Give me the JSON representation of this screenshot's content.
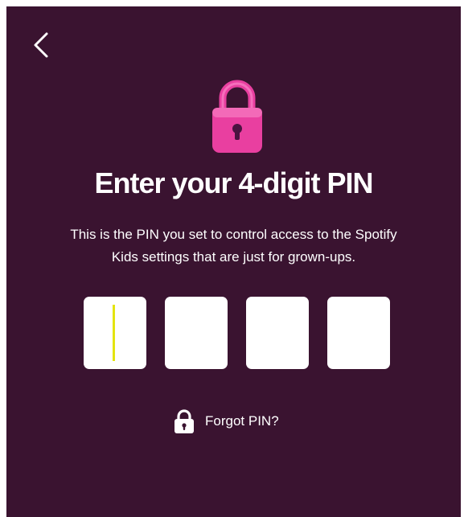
{
  "screen": {
    "background_color": "#3a1330",
    "accent_color": "#e93fa0",
    "caret_color": "#e4e40f"
  },
  "nav": {
    "back_icon": "chevron-left-icon"
  },
  "hero": {
    "icon": "padlock-icon"
  },
  "title": "Enter your 4-digit PIN",
  "subtitle_line1": "This is the PIN you set to control access to the Spotify",
  "subtitle_line2": "Kids settings that are just for grown-ups.",
  "pin": {
    "digits": [
      "",
      "",
      "",
      ""
    ],
    "focused_index": 0
  },
  "forgot": {
    "icon": "padlock-icon",
    "label": "Forgot PIN?"
  }
}
